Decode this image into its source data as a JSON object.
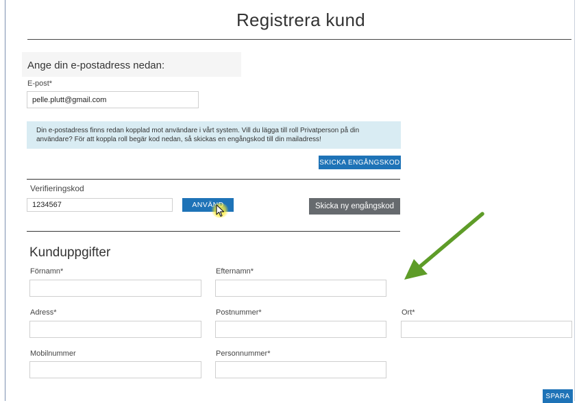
{
  "page": {
    "title": "Registrera kund"
  },
  "email_section": {
    "heading": "Ange din e-postadress nedan:",
    "email_label": "E-post*",
    "email_value": "pelle.plutt@gmail.com",
    "info_message": "Din e-postadress finns redan kopplad mot användare i vårt system. Vill du lägga till roll Privatperson på din användare? För att koppla roll begär kod nedan, så skickas en engångskod till din mailadress!",
    "send_code_button": "SKICKA ENGÅNGSKOD"
  },
  "verification": {
    "label": "Verifieringskod",
    "code_value": "1234567",
    "use_button": "ANVÄND",
    "resend_button": "Skicka ny engångskod"
  },
  "customer": {
    "heading": "Kunduppgifter",
    "first_name_label": "Förnamn*",
    "last_name_label": "Efternamn*",
    "address_label": "Adress*",
    "postal_code_label": "Postnummer*",
    "city_label": "Ort*",
    "mobile_label": "Mobilnummer",
    "personal_id_label": "Personnummer*",
    "first_name_value": "",
    "last_name_value": "",
    "address_value": "",
    "postal_code_value": "",
    "city_value": "",
    "mobile_value": "",
    "personal_id_value": "",
    "save_button": "SPARA"
  },
  "icons": {
    "cursor": "mouse-pointer-icon",
    "arrow": "green-arrow-icon"
  },
  "colors": {
    "primary_button": "#1e73b7",
    "secondary_button": "#666a6e",
    "alert_background": "#d9ecf3",
    "arrow": "#6aa82c"
  }
}
